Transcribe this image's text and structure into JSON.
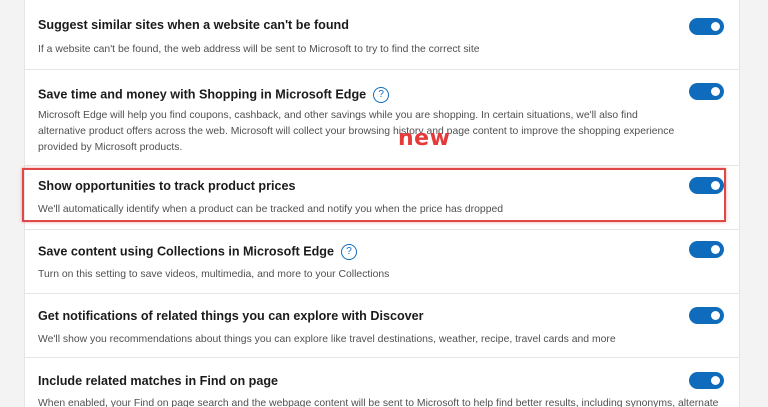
{
  "annotation": {
    "new_label": "new",
    "highlight_color": "#e04848"
  },
  "colors": {
    "toggle_on": "#0f6cbd",
    "title_text": "#1b1b1b",
    "desc_text": "#505050"
  },
  "settings": [
    {
      "title": "Suggest similar sites when a website can't be found",
      "description": "If a website can't be found, the web address will be sent to Microsoft to try to find the correct site",
      "enabled": true,
      "has_help": false
    },
    {
      "title": "Save time and money with Shopping in Microsoft Edge",
      "description": "Microsoft Edge will help you find coupons, cashback, and other savings while you are shopping. In certain situations, we'll also find alternative product offers across the web. Microsoft will collect your browsing history and page content to improve the shopping experience provided by Microsoft products.",
      "enabled": true,
      "has_help": true,
      "help_icon": "question-circle-icon"
    },
    {
      "title": "Show opportunities to track product prices",
      "description": "We'll automatically identify when a product can be tracked and notify you when the price has dropped",
      "enabled": true,
      "has_help": false
    },
    {
      "title": "Save content using Collections in Microsoft Edge",
      "description": "Turn on this setting to save videos, multimedia, and more to your Collections",
      "enabled": true,
      "has_help": true,
      "help_icon": "question-circle-icon"
    },
    {
      "title": "Get notifications of related things you can explore with Discover",
      "description": "We'll show you recommendations about things you can explore like travel destinations, weather, recipe, travel cards and more",
      "enabled": true,
      "has_help": false
    },
    {
      "title": "Include related matches in Find on page",
      "description": "When enabled, your Find on page search and the webpage content will be sent to Microsoft to help find better results, including synonyms, alternate",
      "enabled": true,
      "has_help": false
    }
  ],
  "help_glyph": "?"
}
